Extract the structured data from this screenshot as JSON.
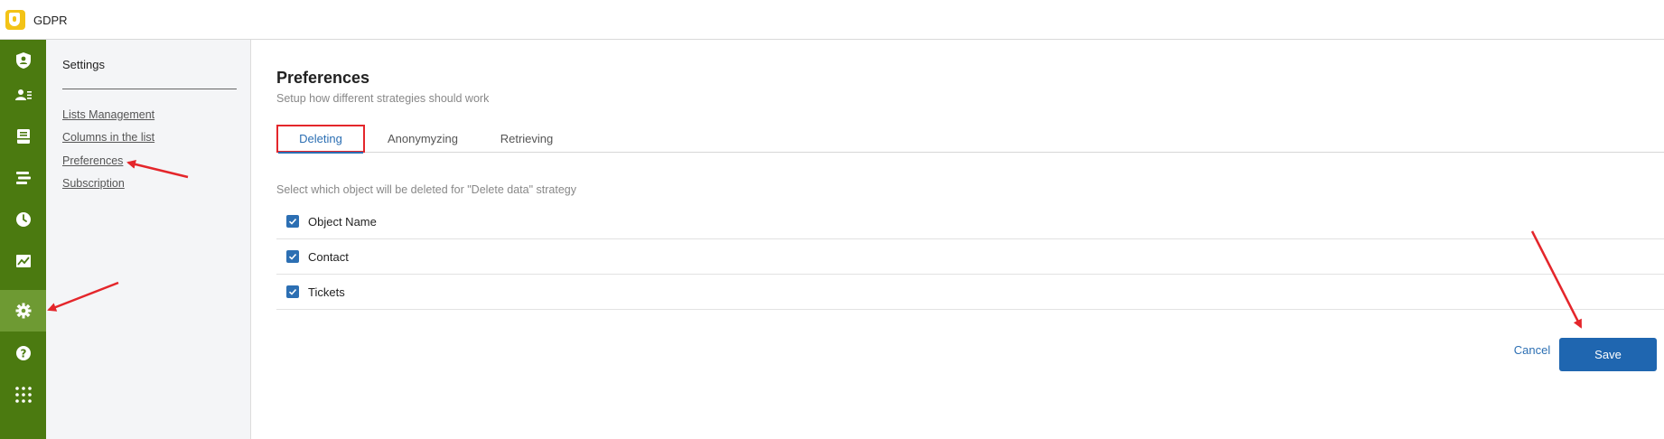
{
  "app": {
    "title": "GDPR"
  },
  "rail": {
    "items": [
      {
        "icon": "shield-user-icon",
        "active": false
      },
      {
        "icon": "contacts-list-icon",
        "active": false
      },
      {
        "icon": "inbox-icon",
        "active": false
      },
      {
        "icon": "bars-list-icon",
        "active": false
      },
      {
        "icon": "clock-icon",
        "active": false
      },
      {
        "icon": "chart-icon",
        "active": false
      },
      {
        "icon": "gear-icon",
        "active": true
      },
      {
        "icon": "help-icon",
        "active": false
      },
      {
        "icon": "apps-grid-icon",
        "active": false
      }
    ]
  },
  "settings": {
    "title": "Settings",
    "links": [
      "Lists Management",
      "Columns in the list",
      "Preferences",
      "Subscription"
    ]
  },
  "page": {
    "title": "Preferences",
    "subtitle": "Setup how different strategies should work"
  },
  "tabs": [
    "Deleting",
    "Anonymyzing",
    "Retrieving"
  ],
  "active_tab": "Deleting",
  "section": {
    "description": "Select which object will be deleted for \"Delete data\" strategy"
  },
  "options": [
    {
      "label": "Object Name",
      "checked": true
    },
    {
      "label": "Contact",
      "checked": true
    },
    {
      "label": "Tickets",
      "checked": true
    }
  ],
  "actions": {
    "cancel": "Cancel",
    "save": "Save"
  },
  "colors": {
    "rail": "#4b7a10",
    "rail_active": "#6e9a33",
    "accent": "#2c6fb3",
    "save_button": "#1f66b0",
    "annotation": "#e4262b",
    "logo": "#f3c316"
  }
}
